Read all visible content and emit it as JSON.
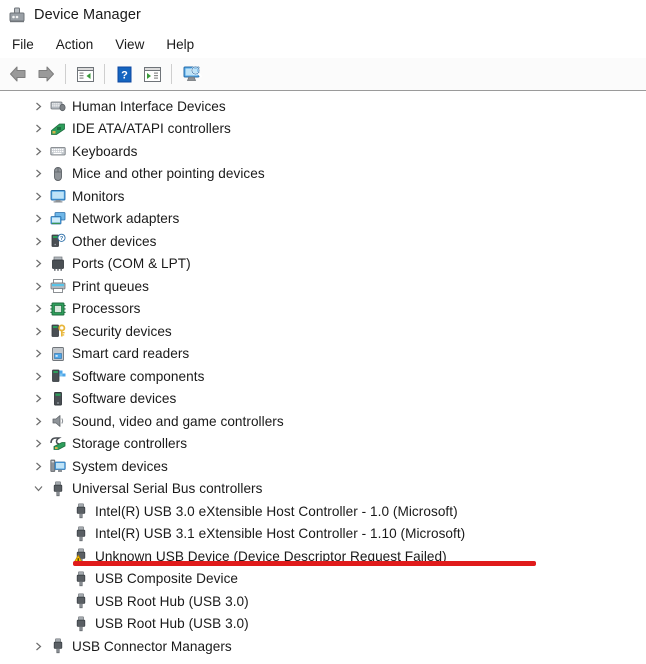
{
  "window": {
    "title": "Device Manager",
    "icon": "device-manager-icon"
  },
  "menubar": {
    "items": [
      {
        "label": "File",
        "name": "menu-file"
      },
      {
        "label": "Action",
        "name": "menu-action"
      },
      {
        "label": "View",
        "name": "menu-view"
      },
      {
        "label": "Help",
        "name": "menu-help"
      }
    ]
  },
  "toolbar": {
    "buttons": [
      {
        "name": "back-button",
        "icon": "back-arrow-icon",
        "tooltip": "Back"
      },
      {
        "name": "forward-button",
        "icon": "forward-arrow-icon",
        "tooltip": "Forward"
      },
      {
        "name": "properties-button",
        "icon": "properties-icon",
        "tooltip": "Properties"
      },
      {
        "name": "help-button",
        "icon": "help-question-icon",
        "tooltip": "Help"
      },
      {
        "name": "update-driver-button",
        "icon": "update-driver-icon",
        "tooltip": "Update Driver"
      },
      {
        "name": "scan-hardware-button",
        "icon": "scan-for-hardware-changes-icon",
        "tooltip": "Scan for hardware changes"
      }
    ]
  },
  "tree": {
    "items": [
      {
        "label": "Human Interface Devices",
        "icon": "hid-icon",
        "state": "collapsed",
        "level": 1
      },
      {
        "label": "IDE ATA/ATAPI controllers",
        "icon": "ide-controller-icon",
        "state": "collapsed",
        "level": 1
      },
      {
        "label": "Keyboards",
        "icon": "keyboard-icon",
        "state": "collapsed",
        "level": 1
      },
      {
        "label": "Mice and other pointing devices",
        "icon": "mouse-icon",
        "state": "collapsed",
        "level": 1
      },
      {
        "label": "Monitors",
        "icon": "monitor-icon",
        "state": "collapsed",
        "level": 1
      },
      {
        "label": "Network adapters",
        "icon": "network-adapter-icon",
        "state": "collapsed",
        "level": 1
      },
      {
        "label": "Other devices",
        "icon": "other-device-icon",
        "state": "collapsed",
        "level": 1
      },
      {
        "label": "Ports (COM & LPT)",
        "icon": "port-icon",
        "state": "collapsed",
        "level": 1
      },
      {
        "label": "Print queues",
        "icon": "printer-icon",
        "state": "collapsed",
        "level": 1
      },
      {
        "label": "Processors",
        "icon": "processor-icon",
        "state": "collapsed",
        "level": 1
      },
      {
        "label": "Security devices",
        "icon": "security-device-icon",
        "state": "collapsed",
        "level": 1
      },
      {
        "label": "Smart card readers",
        "icon": "smart-card-reader-icon",
        "state": "collapsed",
        "level": 1
      },
      {
        "label": "Software components",
        "icon": "software-component-icon",
        "state": "collapsed",
        "level": 1
      },
      {
        "label": "Software devices",
        "icon": "software-device-icon",
        "state": "collapsed",
        "level": 1
      },
      {
        "label": "Sound, video and game controllers",
        "icon": "sound-controller-icon",
        "state": "collapsed",
        "level": 1
      },
      {
        "label": "Storage controllers",
        "icon": "storage-controller-icon",
        "state": "collapsed",
        "level": 1
      },
      {
        "label": "System devices",
        "icon": "system-device-icon",
        "state": "collapsed",
        "level": 1
      },
      {
        "label": "Universal Serial Bus controllers",
        "icon": "usb-icon",
        "state": "expanded",
        "level": 1
      },
      {
        "label": "Intel(R) USB 3.0 eXtensible Host Controller - 1.0 (Microsoft)",
        "icon": "usb-icon",
        "state": "leaf",
        "level": 2
      },
      {
        "label": "Intel(R) USB 3.1 eXtensible Host Controller - 1.10 (Microsoft)",
        "icon": "usb-icon",
        "state": "leaf",
        "level": 2
      },
      {
        "label": "Unknown USB Device (Device Descriptor Request Failed)",
        "icon": "usb-warning-icon",
        "state": "leaf",
        "level": 2,
        "warning": true
      },
      {
        "label": "USB Composite Device",
        "icon": "usb-icon",
        "state": "leaf",
        "level": 2
      },
      {
        "label": "USB Root Hub (USB 3.0)",
        "icon": "usb-icon",
        "state": "leaf",
        "level": 2
      },
      {
        "label": "USB Root Hub (USB 3.0)",
        "icon": "usb-icon",
        "state": "leaf",
        "level": 2
      },
      {
        "label": "USB Connector Managers",
        "icon": "usb-icon",
        "state": "collapsed",
        "level": 1
      }
    ]
  },
  "annotation": {
    "name": "red-underline-highlight",
    "color": "#e01b1b",
    "targets": "Unknown USB Device (Device Descriptor Request Failed)"
  },
  "colors": {
    "background": "#ffffff",
    "text": "#1a1a1a",
    "toolbar_bg": "#fbfbfb",
    "toolbar_border": "#9a9a9a",
    "chevron": "#6d6d6d",
    "annotation_red": "#e01b1b",
    "warning_yellow": "#ffc400"
  }
}
